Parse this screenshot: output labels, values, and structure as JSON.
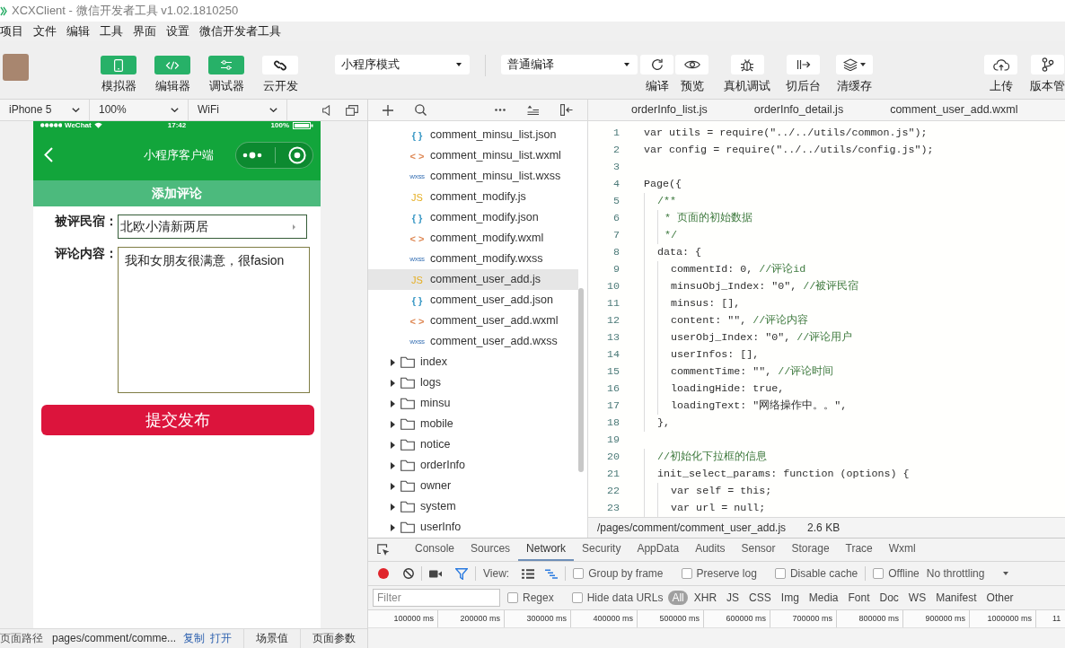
{
  "window": {
    "title": "XCXClient - 微信开发者工具 v1.02.1810250"
  },
  "menu": [
    "项目",
    "文件",
    "编辑",
    "工具",
    "界面",
    "设置",
    "微信开发者工具"
  ],
  "toolbar": {
    "panels": [
      {
        "label": "模拟器",
        "on": true
      },
      {
        "label": "编辑器",
        "on": true
      },
      {
        "label": "调试器",
        "on": true
      },
      {
        "label": "云开发",
        "on": false
      }
    ],
    "mode_select": "小程序模式",
    "compile_select": "普通编译",
    "actions": [
      "编译",
      "预览",
      "真机调试",
      "切后台",
      "清缓存"
    ],
    "publish_actions": [
      "上传",
      "版本管"
    ]
  },
  "simulator": {
    "selects": [
      "iPhone 5",
      "100%",
      "WiFi"
    ],
    "status_bar": {
      "carrier": "WeChat",
      "time": "17:42",
      "battery": "100%"
    },
    "nav_bar": {
      "title": "小程序客户端"
    },
    "page": {
      "header": "添加评论",
      "fields": [
        {
          "kind": "select",
          "label": "被评民宿：",
          "value": "北欧小清新两居"
        },
        {
          "kind": "textarea",
          "label": "评论内容：",
          "value": "我和女朋友很满意，很fasion"
        }
      ],
      "submit": "提交发布"
    },
    "footer": {
      "path_label": "页面路径",
      "path": "pages/comment/comme...",
      "links": [
        "复制",
        "打开"
      ],
      "tabs": [
        "场景值",
        "页面参数"
      ]
    }
  },
  "file_tree": {
    "items": [
      {
        "kind": "group",
        "children": [
          {
            "kind": "json",
            "icon": "{ }",
            "label": "comment_minsu_list.json",
            "selected": false
          },
          {
            "kind": "wxml",
            "icon": "< >",
            "label": "comment_minsu_list.wxml",
            "selected": false
          },
          {
            "kind": "wxss",
            "icon": "wxss",
            "label": "comment_minsu_list.wxss",
            "selected": false
          },
          {
            "kind": "js",
            "icon": "JS",
            "label": "comment_modify.js",
            "selected": false
          },
          {
            "kind": "json",
            "icon": "{ }",
            "label": "comment_modify.json",
            "selected": false
          },
          {
            "kind": "wxml",
            "icon": "< >",
            "label": "comment_modify.wxml",
            "selected": false
          },
          {
            "kind": "wxss",
            "icon": "wxss",
            "label": "comment_modify.wxss",
            "selected": false
          },
          {
            "kind": "js",
            "icon": "JS",
            "label": "comment_user_add.js",
            "selected": true
          },
          {
            "kind": "json",
            "icon": "{ }",
            "label": "comment_user_add.json",
            "selected": false
          },
          {
            "kind": "wxml",
            "icon": "< >",
            "label": "comment_user_add.wxml",
            "selected": false
          },
          {
            "kind": "wxss",
            "icon": "wxss",
            "label": "comment_user_add.wxss",
            "selected": false
          }
        ]
      },
      {
        "kind": "folder",
        "label": "index",
        "expanded": false,
        "selected": false
      },
      {
        "kind": "folder",
        "label": "logs",
        "expanded": false,
        "selected": false
      },
      {
        "kind": "folder",
        "label": "minsu",
        "expanded": false,
        "selected": false
      },
      {
        "kind": "folder",
        "label": "mobile",
        "expanded": false,
        "selected": false
      },
      {
        "kind": "folder",
        "label": "notice",
        "expanded": false,
        "selected": false
      },
      {
        "kind": "folder",
        "label": "orderInfo",
        "expanded": false,
        "selected": false
      },
      {
        "kind": "folder",
        "label": "owner",
        "expanded": false,
        "selected": false
      },
      {
        "kind": "folder",
        "label": "system",
        "expanded": false,
        "selected": false
      },
      {
        "kind": "folder",
        "label": "userInfo",
        "expanded": false,
        "selected": false
      }
    ]
  },
  "editor": {
    "tabs": [
      "orderInfo_list.js",
      "orderInfo_detail.js",
      "comment_user_add.wxml"
    ],
    "lines": [
      {
        "number": "1",
        "segments": [
          {
            "kind": "code",
            "text": "var utils = require(\"../../utils/common.js\");"
          }
        ]
      },
      {
        "number": "2",
        "segments": [
          {
            "kind": "code",
            "text": "var config = require(\"../../utils/config.js\");"
          }
        ]
      },
      {
        "number": "3"
      },
      {
        "number": "4",
        "segments": [
          {
            "kind": "code",
            "text": "Page({"
          }
        ]
      },
      {
        "number": "5",
        "segments": [
          {
            "kind": "comment",
            "text": "  /**"
          }
        ]
      },
      {
        "number": "6",
        "segments": [
          {
            "kind": "comment",
            "text": "   * 页面的初始数据"
          }
        ]
      },
      {
        "number": "7",
        "segments": [
          {
            "kind": "comment",
            "text": "   */"
          }
        ]
      },
      {
        "number": "8",
        "segments": [
          {
            "kind": "code",
            "text": "  data: {"
          }
        ]
      },
      {
        "number": "9",
        "segments": [
          {
            "kind": "code",
            "text": "    commentId: 0, "
          },
          {
            "kind": "comment",
            "text": "//评论id"
          }
        ]
      },
      {
        "number": "10",
        "segments": [
          {
            "kind": "code",
            "text": "    minsuObj_Index: \"0\", "
          },
          {
            "kind": "comment",
            "text": "//被评民宿"
          }
        ]
      },
      {
        "number": "11",
        "segments": [
          {
            "kind": "code",
            "text": "    minsus: [],"
          }
        ]
      },
      {
        "number": "12",
        "segments": [
          {
            "kind": "code",
            "text": "    content: \"\", "
          },
          {
            "kind": "comment",
            "text": "//评论内容"
          }
        ]
      },
      {
        "number": "13",
        "segments": [
          {
            "kind": "code",
            "text": "    userObj_Index: \"0\", "
          },
          {
            "kind": "comment",
            "text": "//评论用户"
          }
        ]
      },
      {
        "number": "14",
        "segments": [
          {
            "kind": "code",
            "text": "    userInfos: [],"
          }
        ]
      },
      {
        "number": "15",
        "segments": [
          {
            "kind": "code",
            "text": "    commentTime: \"\", "
          },
          {
            "kind": "comment",
            "text": "//评论时间"
          }
        ]
      },
      {
        "number": "16",
        "segments": [
          {
            "kind": "code",
            "text": "    loadingHide: true,"
          }
        ]
      },
      {
        "number": "17",
        "segments": [
          {
            "kind": "code",
            "text": "    loadingText: \"网络操作中。。\","
          }
        ]
      },
      {
        "number": "18",
        "segments": [
          {
            "kind": "code",
            "text": "  },"
          }
        ]
      },
      {
        "number": "19"
      },
      {
        "number": "20",
        "segments": [
          {
            "kind": "comment",
            "text": "  //初始化下拉框的信息"
          }
        ]
      },
      {
        "number": "21",
        "segments": [
          {
            "kind": "code",
            "text": "  init_select_params: function (options) {"
          }
        ]
      },
      {
        "number": "22",
        "segments": [
          {
            "kind": "code",
            "text": "    var self = this;"
          }
        ]
      },
      {
        "number": "23",
        "segments": [
          {
            "kind": "code",
            "text": "    var url = null;"
          }
        ]
      }
    ],
    "status": {
      "path": "/pages/comment/comment_user_add.js",
      "size": "2.6 KB"
    }
  },
  "devtools": {
    "tabs": [
      {
        "label": "Console",
        "selected": false
      },
      {
        "label": "Sources",
        "selected": false
      },
      {
        "label": "Network",
        "selected": true
      },
      {
        "label": "Security",
        "selected": false
      },
      {
        "label": "AppData",
        "selected": false
      },
      {
        "label": "Audits",
        "selected": false
      },
      {
        "label": "Sensor",
        "selected": false
      },
      {
        "label": "Storage",
        "selected": false
      },
      {
        "label": "Trace",
        "selected": false
      },
      {
        "label": "Wxml",
        "selected": false
      }
    ],
    "network_toolbar": {
      "recording": true,
      "filter_active": true,
      "view_label": "View:",
      "options": [
        {
          "label": "Group by frame",
          "checked": false
        },
        {
          "label": "Preserve log",
          "checked": false
        },
        {
          "label": "Disable cache",
          "checked": false
        }
      ],
      "offline": {
        "label": "Offline",
        "checked": false
      },
      "throttling": "No throttling"
    },
    "filter_bar": {
      "placeholder": "Filter",
      "options": [
        {
          "label": "Regex",
          "checked": false
        },
        {
          "label": "Hide data URLs",
          "checked": false
        }
      ],
      "types": [
        {
          "label": "All",
          "selected": true
        },
        {
          "label": "XHR",
          "selected": false
        },
        {
          "label": "JS",
          "selected": false
        },
        {
          "label": "CSS",
          "selected": false
        },
        {
          "label": "Img",
          "selected": false
        },
        {
          "label": "Media",
          "selected": false
        },
        {
          "label": "Font",
          "selected": false
        },
        {
          "label": "Doc",
          "selected": false
        },
        {
          "label": "WS",
          "selected": false
        },
        {
          "label": "Manifest",
          "selected": false
        },
        {
          "label": "Other",
          "selected": false
        }
      ]
    },
    "timeline": {
      "ticks": [
        "100000 ms",
        "200000 ms",
        "300000 ms",
        "400000 ms",
        "500000 ms",
        "600000 ms",
        "700000 ms",
        "800000 ms",
        "900000 ms",
        "1000000 ms",
        "11"
      ]
    }
  }
}
